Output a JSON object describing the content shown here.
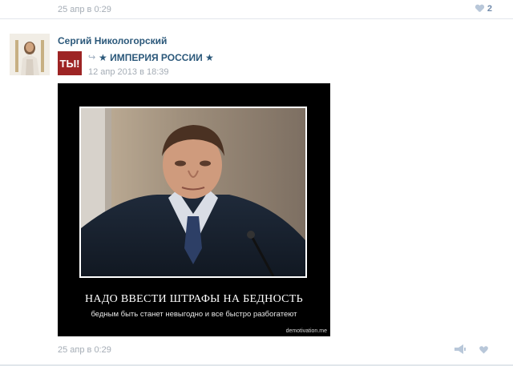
{
  "top_post": {
    "date": "25 апр в 0:29",
    "likes": "2"
  },
  "post": {
    "author": "Сергий Никологорский",
    "repost_group": "★ ИМПЕРИЯ РОССИИ ★",
    "group_logo_text": "ТЫ!",
    "repost_date": "12 апр 2013 в 18:39",
    "image": {
      "caption": "НАДО ВВЕСТИ ШТРАФЫ НА БЕДНОСТЬ",
      "subcaption": "бедным быть станет невыгодно и все быстро разбогатеют",
      "site": "demotivation.me"
    },
    "date": "25 апр в 0:29"
  },
  "colors": {
    "link": "#2b587a",
    "meta": "#a4acb5",
    "icon": "#b8c7d9"
  }
}
